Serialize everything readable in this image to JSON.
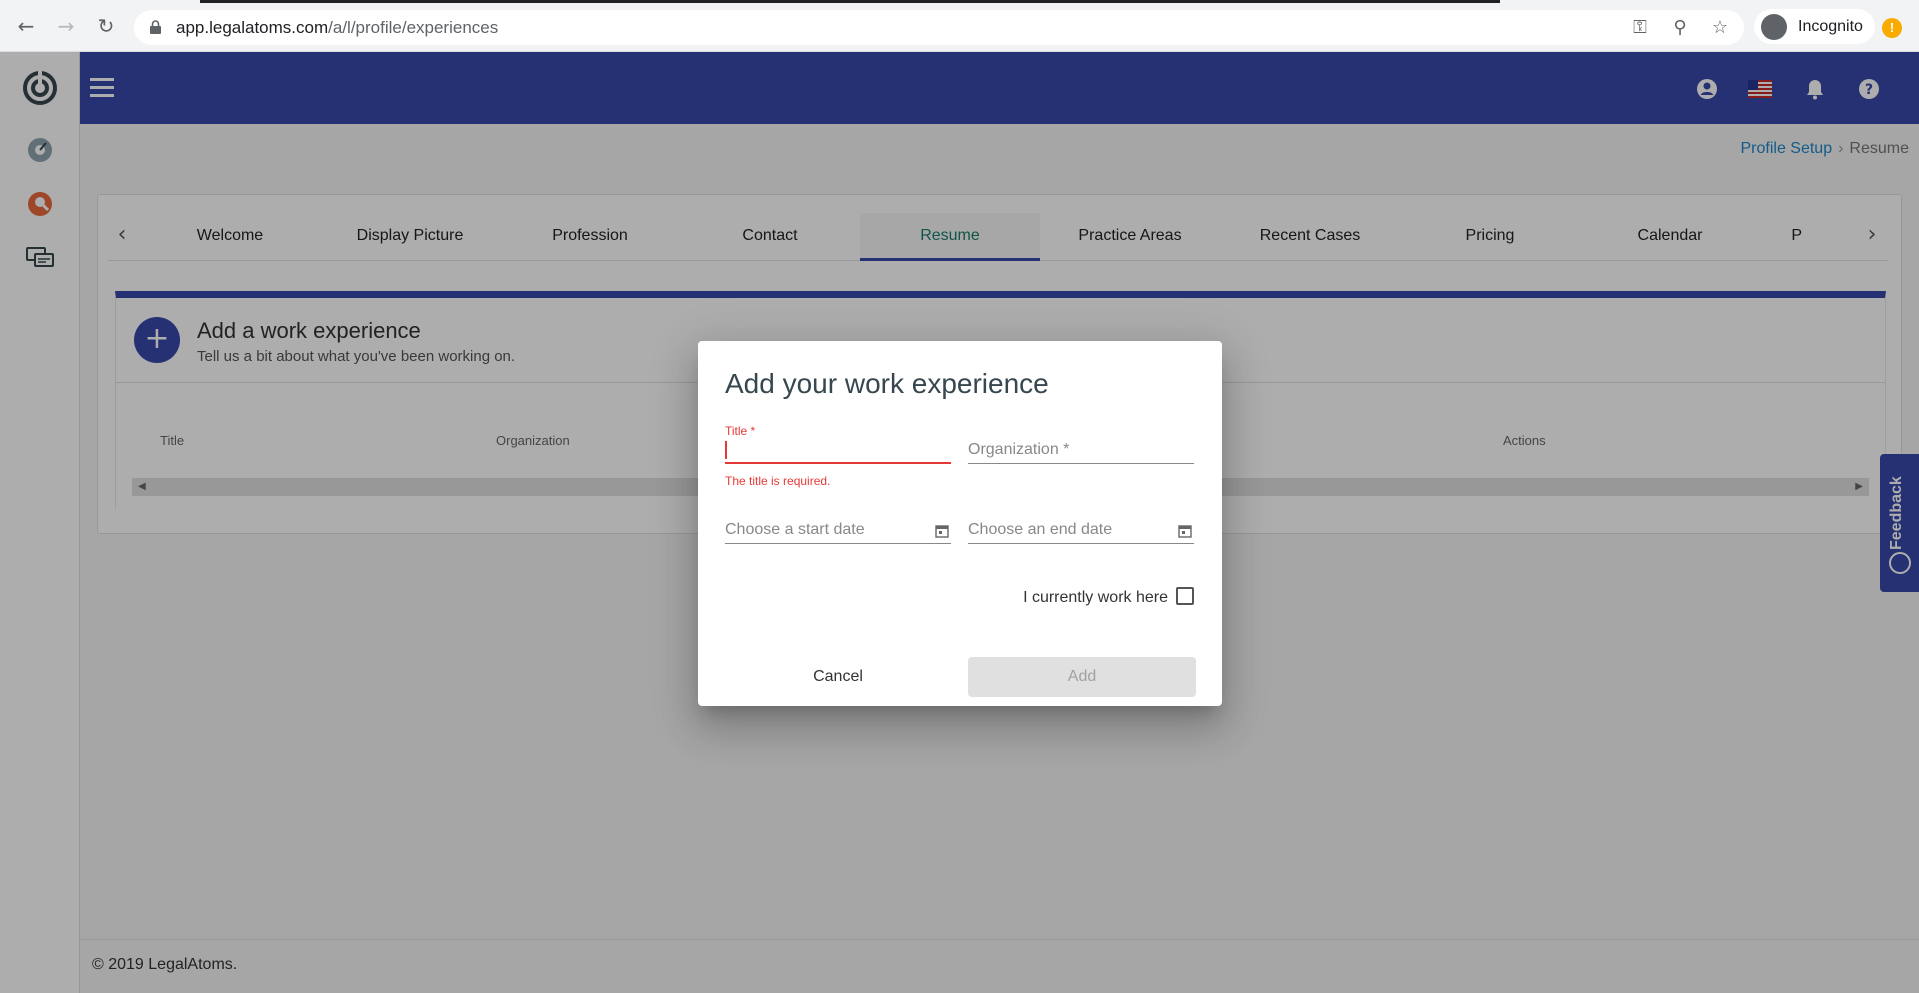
{
  "browser": {
    "url_host": "app.legalatoms.com",
    "url_path": "/a/l/profile/experiences",
    "profile_label": "Incognito",
    "alert_badge": "!"
  },
  "breadcrumb": {
    "parent": "Profile Setup",
    "separator": "›",
    "current": "Resume"
  },
  "tabs": [
    {
      "label": "Welcome"
    },
    {
      "label": "Display Picture"
    },
    {
      "label": "Profession"
    },
    {
      "label": "Contact"
    },
    {
      "label": "Resume",
      "active": true
    },
    {
      "label": "Practice Areas"
    },
    {
      "label": "Recent Cases"
    },
    {
      "label": "Pricing"
    },
    {
      "label": "Calendar"
    },
    {
      "label": "P"
    }
  ],
  "section": {
    "add_icon": "+",
    "title": "Add a work experience",
    "subtitle": "Tell us a bit about what you've been working on.",
    "columns": [
      "Title",
      "Organization",
      "Actions"
    ]
  },
  "dialog": {
    "title": "Add your work experience",
    "title_field": {
      "label": "Title *",
      "value": "",
      "error": "The title is required."
    },
    "organization_field": {
      "placeholder": "Organization *"
    },
    "start_date": {
      "placeholder": "Choose a start date"
    },
    "end_date": {
      "placeholder": "Choose an end date"
    },
    "current_label": "I currently work here",
    "cancel_label": "Cancel",
    "add_label": "Add"
  },
  "footer": {
    "copyright": "© 2019 LegalAtoms."
  },
  "feedback_label": "Feedback",
  "colors": {
    "primary": "#3949ab",
    "error": "#e53935",
    "active_tab_text": "#1a7d6a",
    "link": "#1e88c9"
  },
  "icons": [
    "back-icon",
    "forward-icon",
    "reload-icon",
    "lock-icon",
    "key-icon",
    "zoom-icon",
    "star-icon",
    "incognito-icon",
    "logo-icon",
    "dashboard-icon",
    "search-profile-icon",
    "chat-icon",
    "menu-icon",
    "account-icon",
    "us-flag-icon",
    "bell-icon",
    "help-icon",
    "calendar-icon",
    "chevron-left-icon",
    "chevron-right-icon"
  ]
}
